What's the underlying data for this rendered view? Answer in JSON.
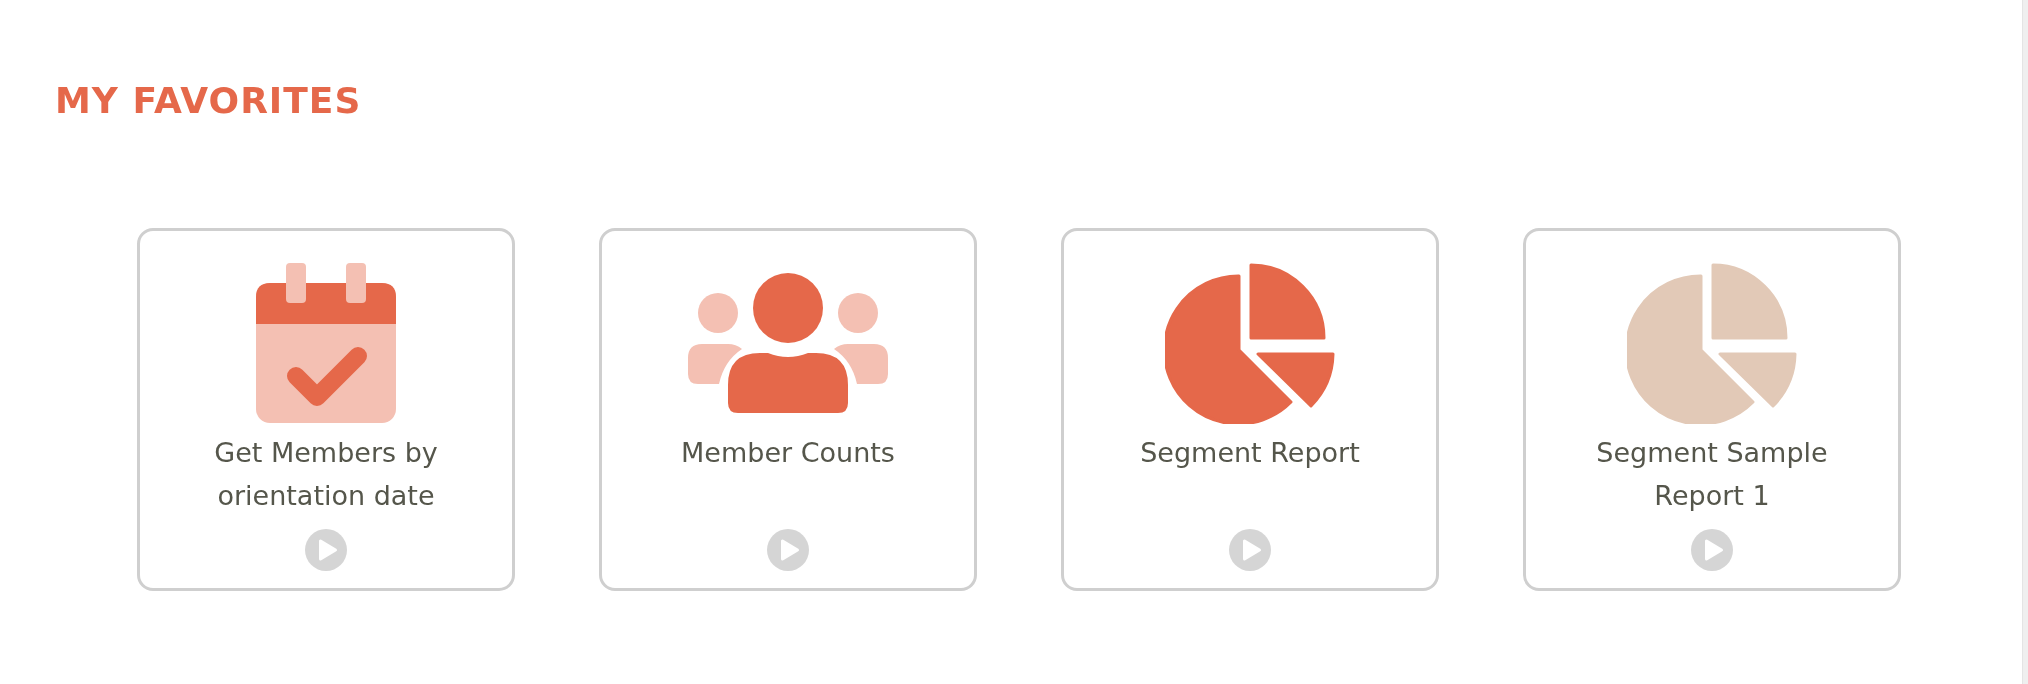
{
  "section": {
    "title": "MY FAVORITES"
  },
  "cards": [
    {
      "kind": "calendar",
      "title": "Get Members by orientation date",
      "color": "#e5684a"
    },
    {
      "kind": "people",
      "title": "Member Counts",
      "color": "#e5684a"
    },
    {
      "kind": "pie",
      "title": "Segment Report",
      "color": "#e5684a"
    },
    {
      "kind": "pie",
      "title": "Segment Sample Report 1",
      "color": "#e2c9b7"
    }
  ]
}
